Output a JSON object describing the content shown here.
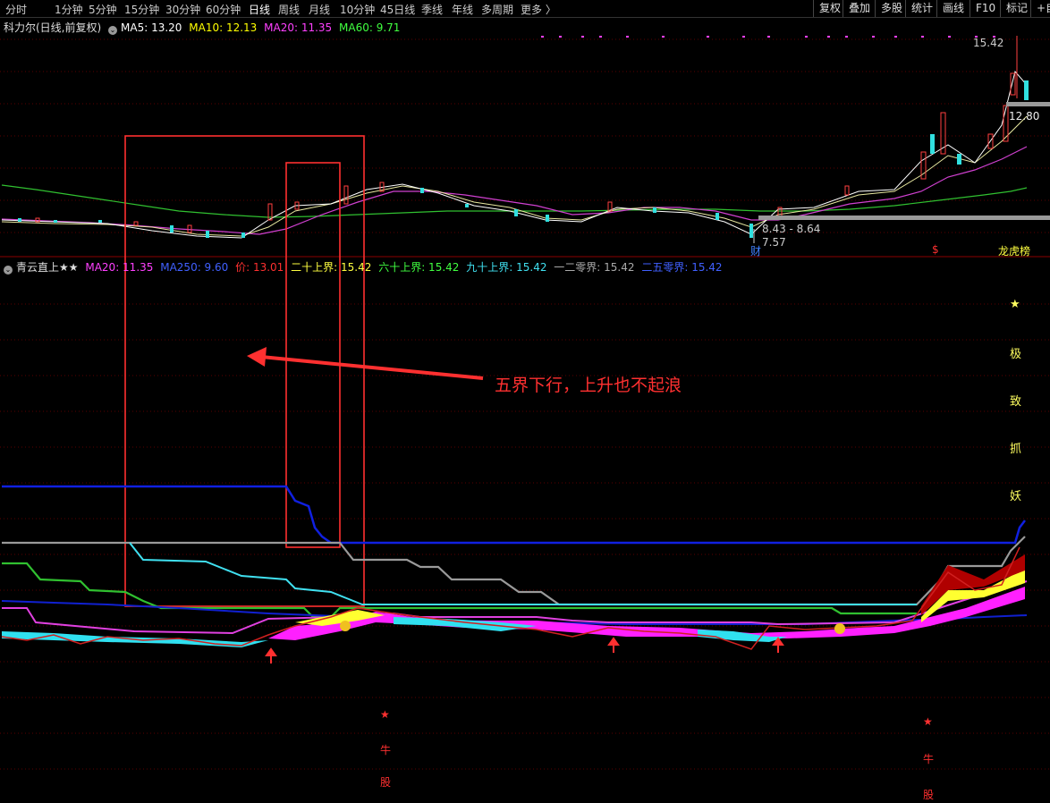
{
  "toolbar": {
    "periods": [
      "分时",
      "1分钟",
      "5分钟",
      "15分钟",
      "30分钟",
      "60分钟",
      "日线",
      "周线",
      "月线",
      "10分钟",
      "45日线",
      "季线",
      "年线",
      "多周期",
      "更多 〉"
    ],
    "active_index": 6,
    "right_buttons": [
      "复权",
      "叠加",
      "多股",
      "统计",
      "画线",
      "F10",
      "标记",
      "+自"
    ]
  },
  "main_legend": {
    "title": "科力尔(日线,前复权)",
    "ma5": "MA5: 13.20",
    "ma10": "MA10: 12.13",
    "ma20": "MA20: 11.35",
    "ma60": "MA60: 9.71",
    "colors": {
      "ma5": "#ffffff",
      "ma10": "#ffff00",
      "ma20": "#ff40ff",
      "ma60": "#40ff40"
    }
  },
  "price_labels": {
    "high": "15.42",
    "last": "12.80",
    "range": "8.43 - 8.64",
    "low": "7.57"
  },
  "markers": {
    "fin": "财",
    "dollar": "$",
    "rank": "龙虎榜"
  },
  "sub_legend": {
    "title": "青云直上★★",
    "ma20": "MA20: 11.35",
    "ma250": "MA250: 9.60",
    "price": "价: 13.01",
    "b20": "二十上界: 15.42",
    "b60": "六十上界: 15.42",
    "b90": "九十上界: 15.42",
    "b120": "一二零界: 15.42",
    "b250": "二五零界: 15.42"
  },
  "annotation": "五界下行，上升也不起浪",
  "side_labels": [
    "★",
    "极",
    "致",
    "抓",
    "妖"
  ],
  "signals": {
    "star": "★",
    "niu": "牛",
    "gu": "股"
  }
}
